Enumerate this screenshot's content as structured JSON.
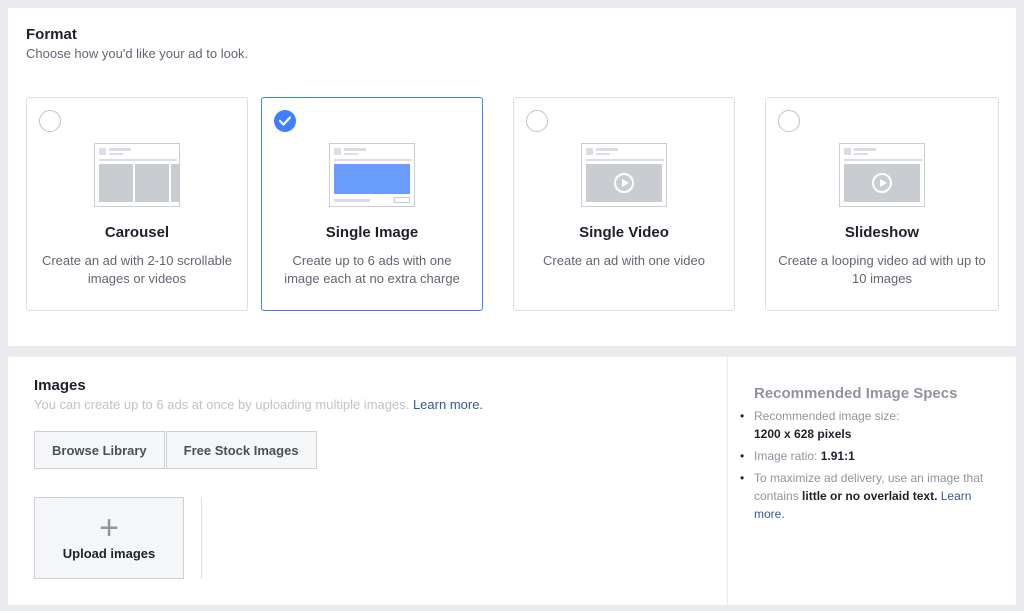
{
  "format": {
    "title": "Format",
    "subtitle": "Choose how you'd like your ad to look.",
    "cards": [
      {
        "name": "Carousel",
        "description": "Create an ad with 2-10 scrollable images or videos",
        "selected": false,
        "thumb": "carousel"
      },
      {
        "name": "Single Image",
        "description": "Create up to 6 ads with one image each at no extra charge",
        "selected": true,
        "thumb": "single-image"
      },
      {
        "name": "Single Video",
        "description": "Create an ad with one video",
        "selected": false,
        "thumb": "video"
      },
      {
        "name": "Slideshow",
        "description": "Create a looping video ad with up to 10 images",
        "selected": false,
        "thumb": "video"
      }
    ],
    "accent_color": "#4080ff"
  },
  "images": {
    "title": "Images",
    "subtitle": "You can create up to 6 ads at once by uploading multiple images.",
    "learn_more": "Learn more.",
    "browse_library": "Browse Library",
    "free_stock": "Free Stock Images",
    "upload_label": "Upload images",
    "upload_icon": "+"
  },
  "specs": {
    "title": "Recommended Image Specs",
    "size_label": "Recommended image size:",
    "size_value": "1200 x 628 pixels",
    "ratio_label": "Image ratio:",
    "ratio_value": "1.91:1",
    "delivery_text": "To maximize ad delivery, use an image that contains",
    "delivery_bold": "little or no overlaid text.",
    "learn_more": "Learn more."
  }
}
